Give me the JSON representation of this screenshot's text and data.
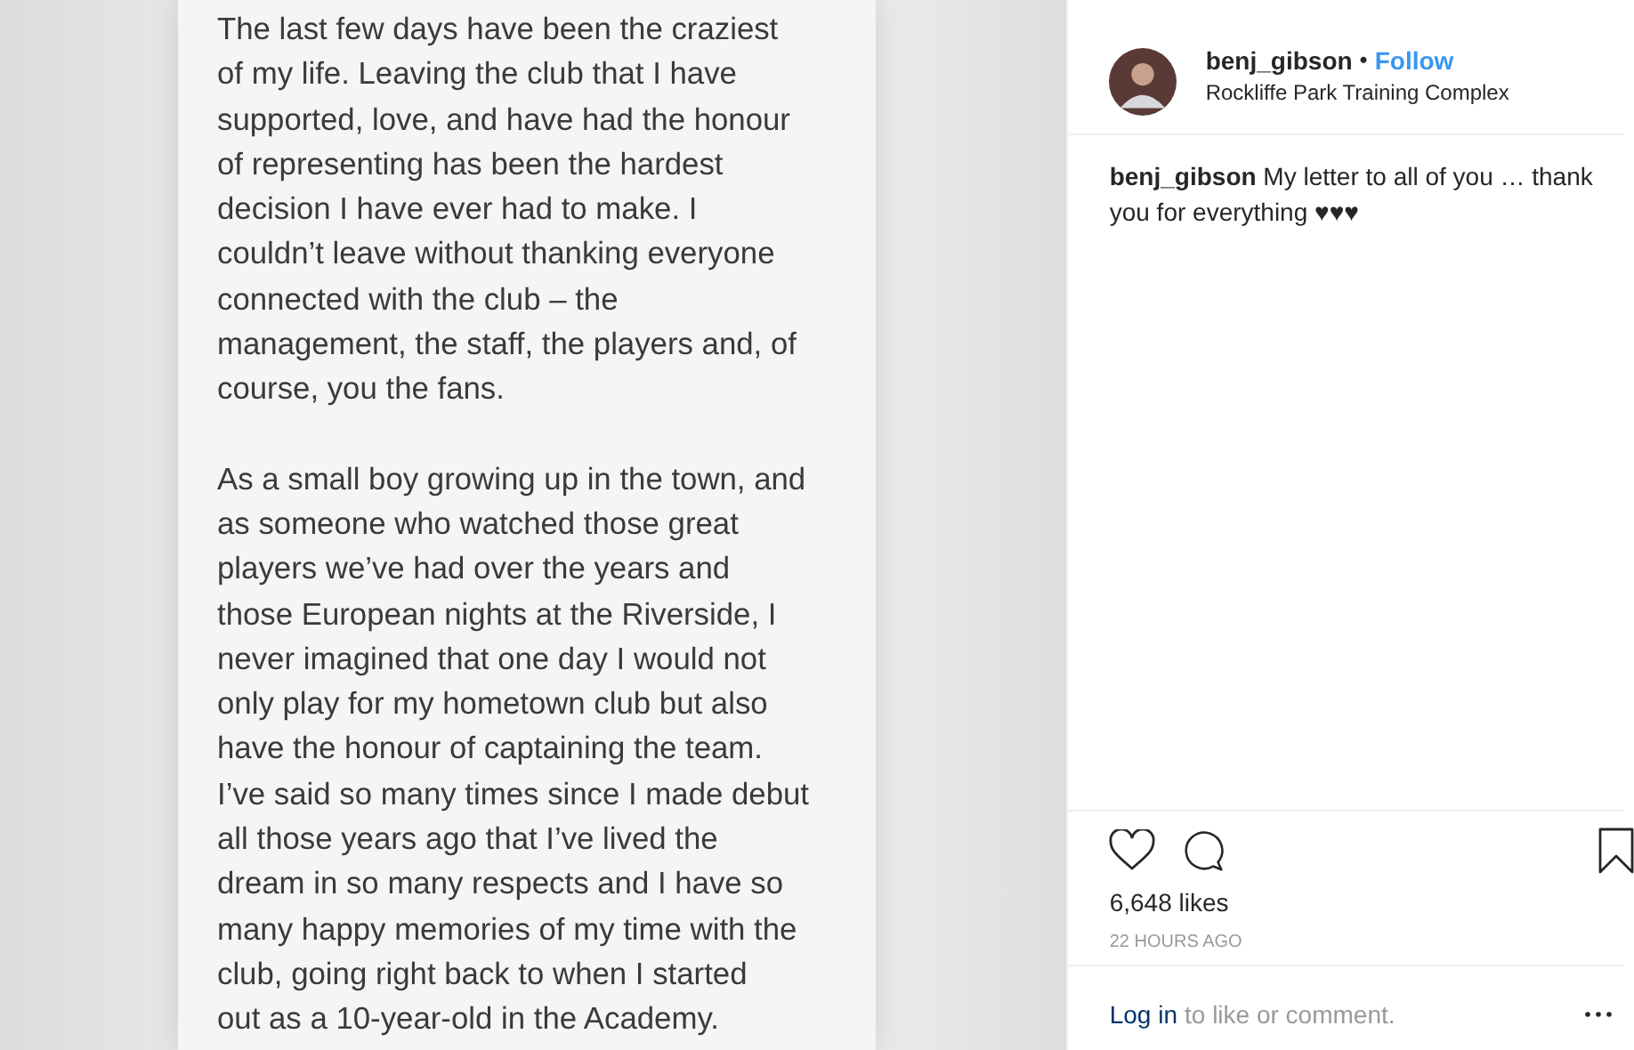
{
  "post_image": {
    "paragraphs": [
      "The last few days have been the craziest\nof my life. Leaving the club that I have\nsupported, love, and have had the honour\nof representing has been the hardest\ndecision I have ever had to make. I\ncouldn’t leave without thanking everyone\nconnected with the club – the\nmanagement, the staff, the players and, of\ncourse, you the fans.",
      "As a small boy growing up in the town, and\nas someone who watched those great\nplayers we’ve had over the years and\nthose European nights at the Riverside, I\nnever imagined that one day I would not\nonly play for my hometown club but also\nhave the honour of captaining the team.\nI’ve said so many times since I made debut\nall those years ago that I’ve lived the\ndream in so many respects and I have so\nmany happy memories of my time with the\nclub, going right back to when I started\nout as a 10-year-old in the Academy."
    ]
  },
  "header": {
    "username": "benj_gibson",
    "separator": "•",
    "follow": "Follow",
    "location": "Rockliffe Park Training Complex"
  },
  "caption": "**benj_gibson** My letter to all of you … thank you for everything ♥♥♥",
  "likes": "6,648 likes",
  "time": "22 HOURS AGO",
  "footer": {
    "login": "Log in",
    "prompt": "to like or comment."
  }
}
